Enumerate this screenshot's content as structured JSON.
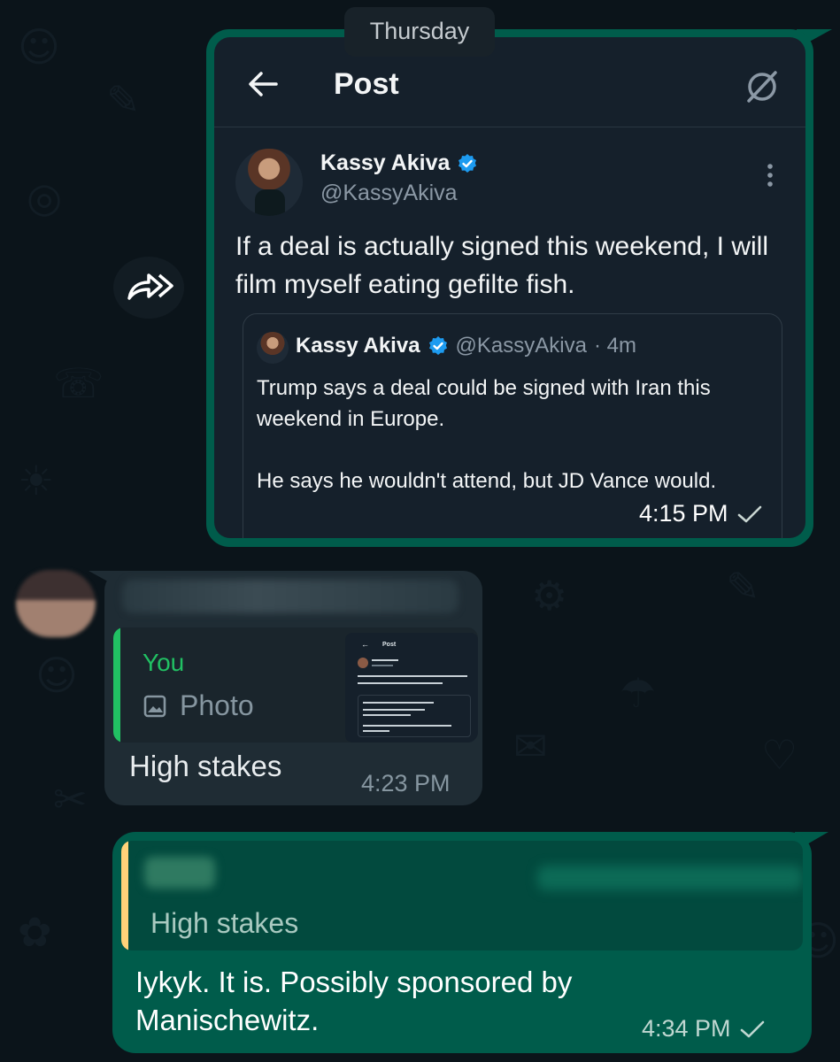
{
  "date_label": "Thursday",
  "messages": {
    "forwarded_post": {
      "time": "4:15 PM",
      "post": {
        "header_title": "Post",
        "author_name": "Kassy Akiva",
        "author_handle": "@KassyAkiva",
        "text": "If a deal is actually signed this weekend, I will film myself eating gefilte fish.",
        "quoted": {
          "author_name": "Kassy Akiva",
          "author_handle": "@KassyAkiva",
          "age": "· 4m",
          "paragraph_1": "Trump says a deal could be signed with Iran this weekend in Europe.",
          "paragraph_2": "He says he wouldn't attend, but JD Vance would."
        }
      }
    },
    "incoming_reply": {
      "quoted_sender": "You",
      "quoted_type": "Photo",
      "text": "High stakes",
      "time": "4:23 PM"
    },
    "outgoing_reply": {
      "quoted_text": "High stakes",
      "text": "Iykyk. It is. Possibly sponsored by Manischewitz.",
      "time": "4:34 PM"
    }
  },
  "colors": {
    "background": "#0b141a",
    "outgoing_bubble": "#005c4b",
    "incoming_bubble": "#1f2c34",
    "reply_accent_you": "#21c063",
    "reply_accent_other": "#ffd279",
    "verified_blue": "#1d9bf0"
  }
}
